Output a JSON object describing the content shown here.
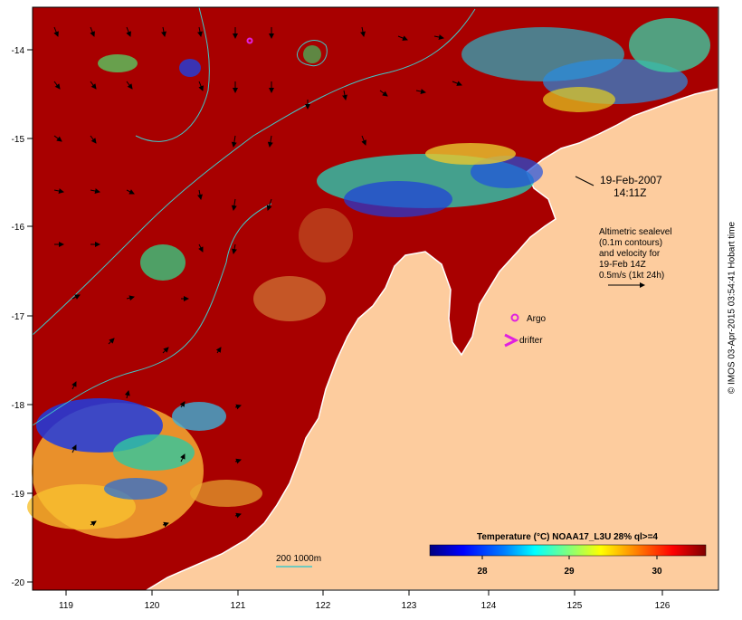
{
  "map": {
    "title": "Temperature (°C) NOAA17_L3U 28% ql>=4",
    "date": "19-Feb-2007",
    "time": "14:11Z",
    "altimetry_lines": [
      "Altimetric sealevel",
      "(0.1m contours)",
      "and velocity for",
      "19-Feb 14Z",
      "0.5m/s (1kt 24h)"
    ],
    "legend": {
      "argo_label": "Argo",
      "drifter_label": "drifter",
      "isobath_label": "200  1000m"
    },
    "credit": "© IMOS 03-Apr-2015 03:54:41 Hobart time",
    "x_ticks": [
      "119",
      "120",
      "121",
      "122",
      "123",
      "124",
      "125",
      "126"
    ],
    "y_ticks": [
      "-14",
      "-15",
      "-16",
      "-17",
      "-18",
      "-19",
      "-20"
    ],
    "colorbar_ticks": [
      "28",
      "29",
      "30"
    ],
    "colors": {
      "warm": "#a80000",
      "land": "#fdcc9e",
      "contour": "#40c8c8",
      "argo": "#e020e0",
      "colorbar": [
        "#00007f",
        "#0000ff",
        "#007fff",
        "#00ffff",
        "#7fff7f",
        "#ffff00",
        "#ff7f00",
        "#ff0000",
        "#7f0000"
      ]
    }
  }
}
